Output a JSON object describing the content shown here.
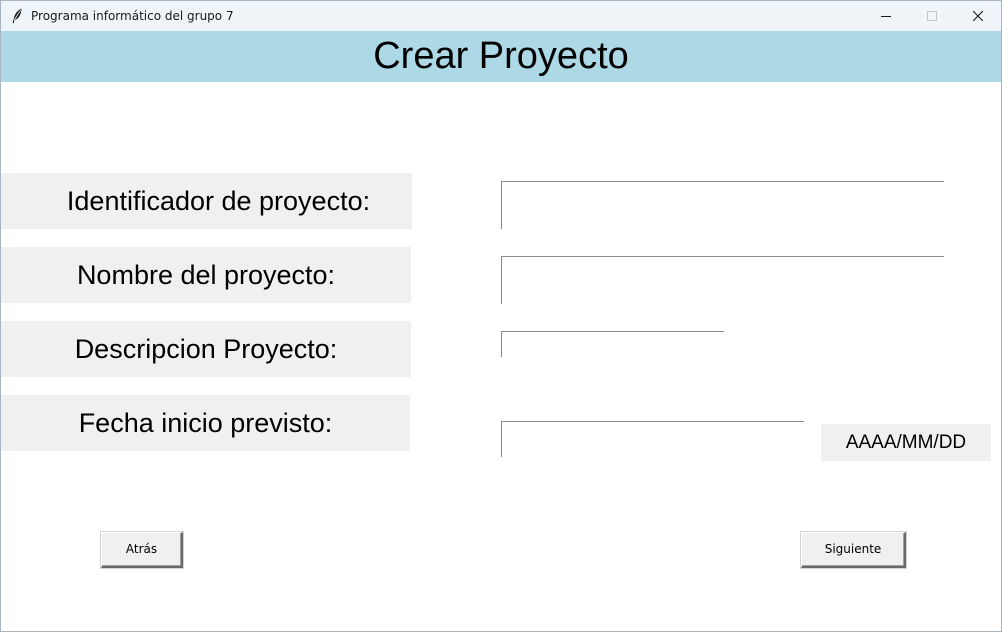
{
  "window": {
    "title": "Programa informático del grupo 7",
    "app_icon": "feather-icon",
    "controls": [
      "minimize-icon",
      "maximize-icon",
      "close-icon"
    ]
  },
  "header": {
    "title": "Crear Proyecto",
    "background_color": "#add8e6"
  },
  "form": {
    "id_label": "Identificador de proyecto:",
    "id_value": "",
    "name_label": "Nombre del proyecto:",
    "name_value": "",
    "description_label": "Descripcion Proyecto:",
    "description_value": "",
    "start_date_label": "Fecha inicio previsto:",
    "start_date_value": "",
    "date_format_hint": "AAAA/MM/DD"
  },
  "buttons": {
    "back_label": "Atrás",
    "next_label": "Siguiente"
  },
  "colors": {
    "label_background": "#f0f0f0",
    "window_background": "#ffffff",
    "titlebar_background": "#eff4f9"
  }
}
